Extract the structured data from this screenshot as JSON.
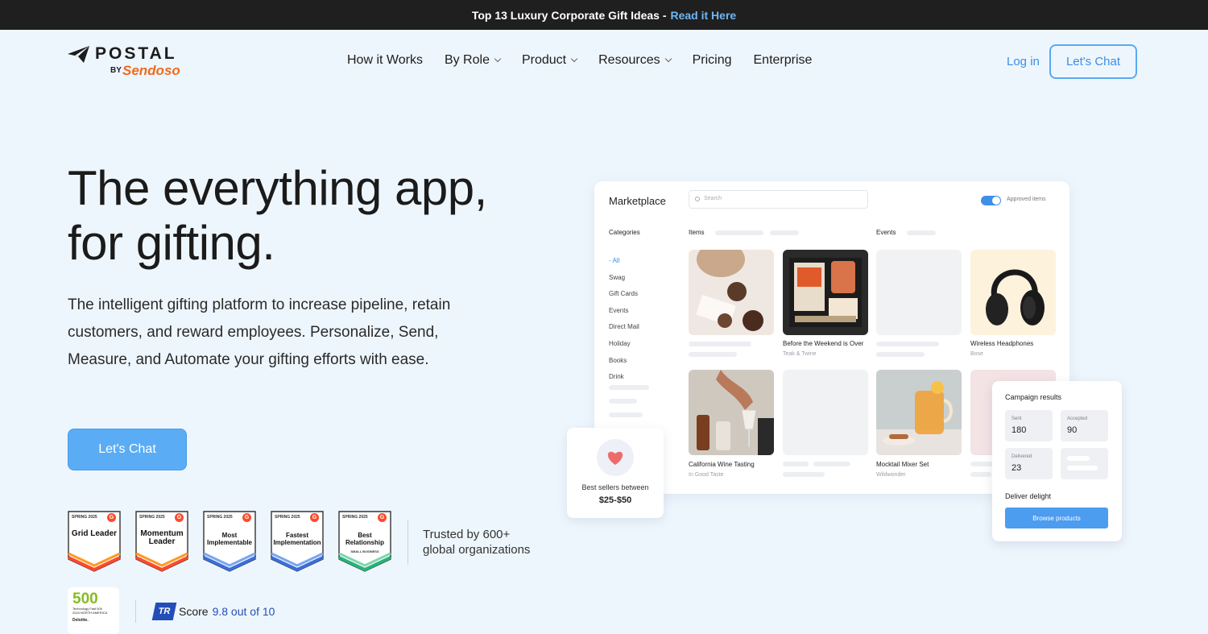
{
  "announcement": {
    "text": "Top 13 Luxury Corporate Gift Ideas -",
    "link": "Read it Here"
  },
  "brand": {
    "name": "POSTAL",
    "by": "BY",
    "parent": "Sendoso"
  },
  "nav": {
    "items": [
      {
        "label": "How it Works",
        "dropdown": false
      },
      {
        "label": "By Role",
        "dropdown": true
      },
      {
        "label": "Product",
        "dropdown": true
      },
      {
        "label": "Resources",
        "dropdown": true
      },
      {
        "label": "Pricing",
        "dropdown": false
      },
      {
        "label": "Enterprise",
        "dropdown": false
      }
    ],
    "login": "Log in",
    "chat": "Let's Chat"
  },
  "hero": {
    "title_line1": "The everything app,",
    "title_line2": "for gifting.",
    "subtitle": "The intelligent gifting platform to increase pipeline, retain customers, and reward employees. Personalize, Send, Measure, and Automate your gifting efforts with ease.",
    "cta": "Let's Chat"
  },
  "badges": [
    {
      "season": "SPRING 2025",
      "title": "Grid Leader",
      "sub": "",
      "color": "#ff492c"
    },
    {
      "season": "SPRING 2025",
      "title": "Momentum Leader",
      "sub": "",
      "color": "#ff9a1f"
    },
    {
      "season": "SPRING 2025",
      "title": "Most Implementable",
      "sub": "",
      "color": "#3a6fd8"
    },
    {
      "season": "SPRING 2025",
      "title": "Fastest Implementation",
      "sub": "",
      "color": "#3a6fd8"
    },
    {
      "season": "SPRING 2025",
      "title": "Best Relationship",
      "sub": "SMALL BUSINESS",
      "color": "#27b37a"
    }
  ],
  "trusted": {
    "line1": "Trusted by 600+",
    "line2": "global organizations"
  },
  "fast500": {
    "num": "500",
    "line1": "Technology Fast 500",
    "line2": "2024 NORTH AMERICA",
    "brand": "Deloitte."
  },
  "trustradius": {
    "logo": "TR",
    "label": "Score",
    "value": "9.8 out of 10"
  },
  "marketplace": {
    "title": "Marketplace",
    "search_placeholder": "Search",
    "approved_label": "Approved items",
    "categories_title": "Categories",
    "categories": [
      "- All",
      "Swag",
      "Gift Cards",
      "Events",
      "Direct Mail",
      "Holiday",
      "Books",
      "Drink"
    ],
    "items_title": "Items",
    "events_title": "Events",
    "products": [
      {
        "name": "Before the Weekend is Over",
        "brand": "Teak & Twine"
      },
      {
        "name": "Wireless Headphones",
        "brand": "Bose"
      },
      {
        "name": "California Wine Tasting",
        "brand": "In Good Taste"
      },
      {
        "name": "Mocktail Mixer Set",
        "brand": "Wildwonder"
      }
    ]
  },
  "best_sellers": {
    "label": "Best sellers between",
    "range": "$25-$50"
  },
  "campaign": {
    "title": "Campaign results",
    "stats": [
      {
        "label": "Sent",
        "value": "180"
      },
      {
        "label": "Accepted",
        "value": "90"
      },
      {
        "label": "Delivered",
        "value": "23"
      }
    ],
    "deliver": "Deliver delight",
    "browse": "Browse products"
  }
}
